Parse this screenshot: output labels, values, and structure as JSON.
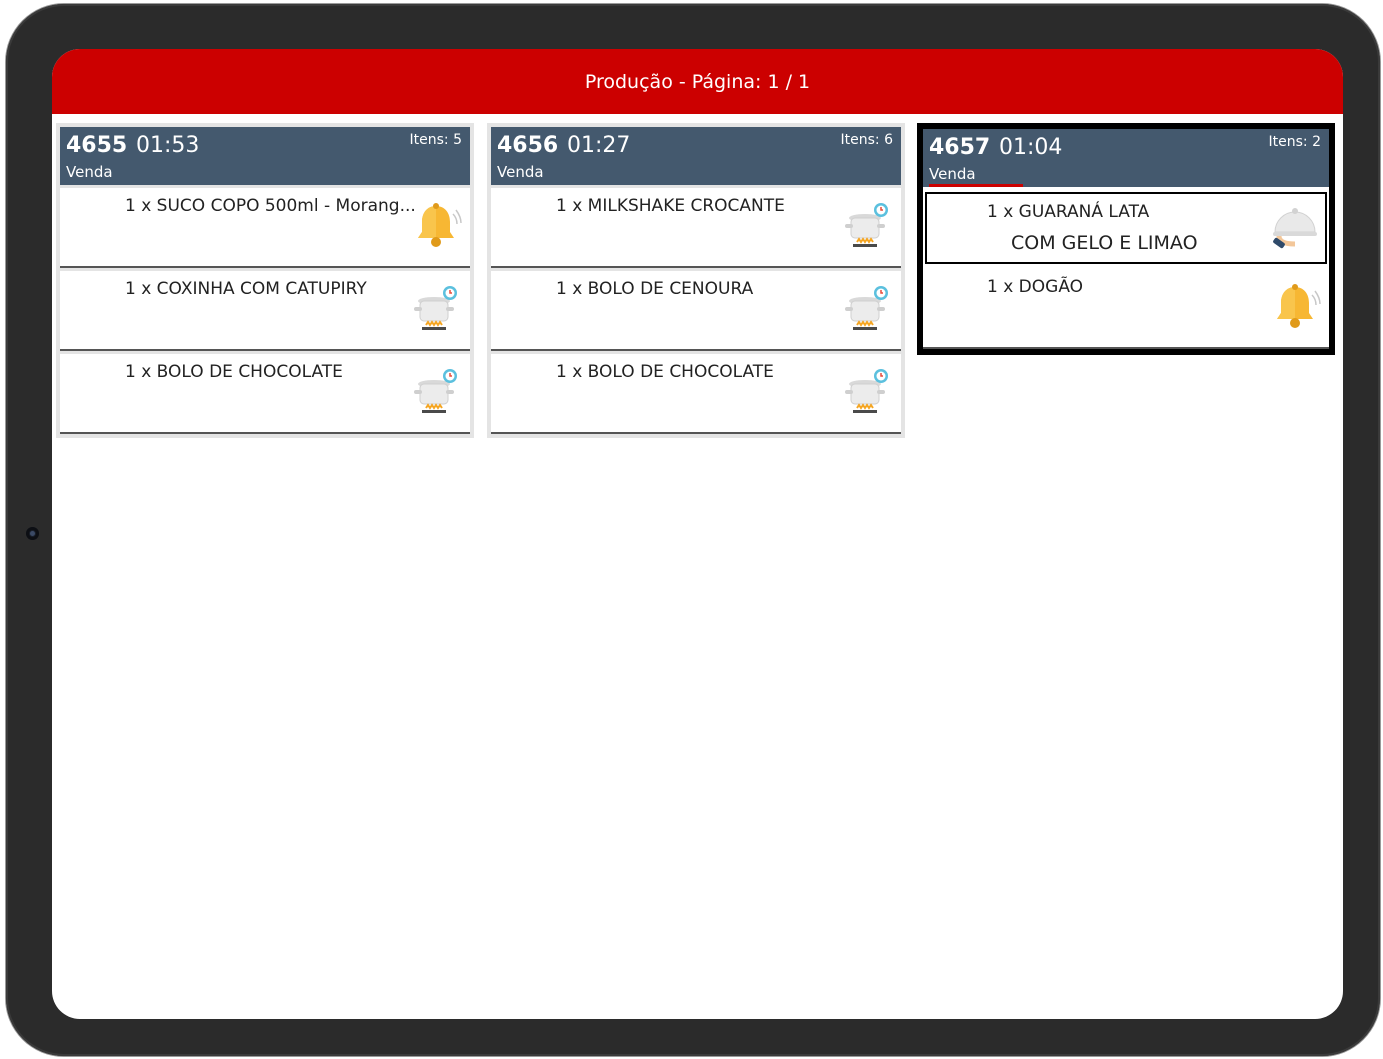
{
  "header": {
    "title": "Produção - Página: 1 / 1"
  },
  "orders": [
    {
      "number": "4655",
      "time": "01:53",
      "type": "Venda",
      "items_label": "Itens: 5",
      "items": [
        {
          "text": "1 x SUCO COPO 500ml - Morang...",
          "icon": "bell-icon"
        },
        {
          "text": "1 x COXINHA COM CATUPIRY",
          "icon": "cooking-pot-icon"
        },
        {
          "text": "1 x BOLO DE CHOCOLATE",
          "icon": "cooking-pot-icon"
        }
      ]
    },
    {
      "number": "4656",
      "time": "01:27",
      "type": "Venda",
      "items_label": "Itens: 6",
      "items": [
        {
          "text": "1 x MILKSHAKE CROCANTE",
          "icon": "cooking-pot-icon"
        },
        {
          "text": "1 x BOLO DE CENOURA",
          "icon": "cooking-pot-icon"
        },
        {
          "text": "1 x BOLO DE CHOCOLATE",
          "icon": "cooking-pot-icon"
        }
      ]
    },
    {
      "number": "4657",
      "time": "01:04",
      "type": "Venda",
      "items_label": "Itens: 2",
      "items": [
        {
          "text": "1 x GUARANÁ LATA",
          "note": "COM GELO E LIMAO",
          "icon": "serving-cloche-icon"
        },
        {
          "text": "1 x DOGÃO",
          "icon": "bell-icon"
        }
      ]
    }
  ],
  "colors": {
    "header_red": "#cc0000",
    "card_header": "#44596e"
  }
}
